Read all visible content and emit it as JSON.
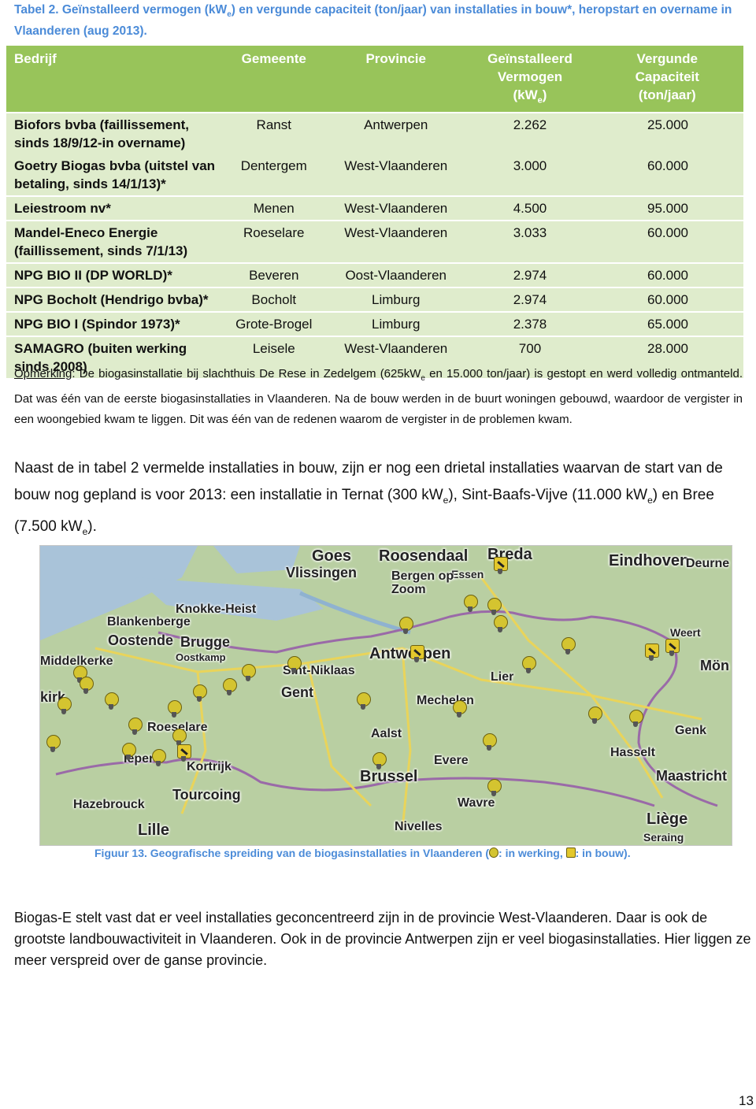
{
  "table_caption": {
    "part1": "Tabel 2. Geïnstalleerd vermogen (kW",
    "sub": "e",
    "part2": ") en vergunde capaciteit (ton/jaar) van installaties in bouw*, heropstart en overname in Vlaanderen (aug 2013)."
  },
  "table": {
    "headers": {
      "bedrijf": "Bedrijf",
      "gemeente": "Gemeente",
      "provincie": "Provincie",
      "vermogen_line1": "Geïnstalleerd",
      "vermogen_line2": "Vermogen",
      "vermogen_line3a": "(kW",
      "vermogen_sub": "e",
      "vermogen_line3b": ")",
      "capaciteit_line1": "Vergunde",
      "capaciteit_line2": "Capaciteit",
      "capaciteit_line3": "(ton/jaar)"
    },
    "rows": [
      {
        "bedrijf": "Biofors bvba (faillissement, sinds 18/9/12-in overname)",
        "gemeente": "Ranst",
        "provincie": "Antwerpen",
        "vermogen": "2.262",
        "capaciteit": "25.000"
      },
      {
        "bedrijf": "Goetry Biogas bvba (uitstel van betaling, sinds 14/1/13)*",
        "gemeente": "Dentergem",
        "provincie": "West-Vlaanderen",
        "vermogen": "3.000",
        "capaciteit": "60.000"
      },
      {
        "bedrijf": "Leiestroom nv*",
        "gemeente": "Menen",
        "provincie": "West-Vlaanderen",
        "vermogen": "4.500",
        "capaciteit": "95.000"
      },
      {
        "bedrijf": "Mandel-Eneco Energie (faillissement, sinds 7/1/13)",
        "gemeente": "Roeselare",
        "provincie": "West-Vlaanderen",
        "vermogen": "3.033",
        "capaciteit": "60.000"
      },
      {
        "bedrijf": "NPG BIO II (DP WORLD)*",
        "gemeente": "Beveren",
        "provincie": "Oost-Vlaanderen",
        "vermogen": "2.974",
        "capaciteit": "60.000"
      },
      {
        "bedrijf": "NPG Bocholt (Hendrigo bvba)*",
        "gemeente": "Bocholt",
        "provincie": "Limburg",
        "vermogen": "2.974",
        "capaciteit": "60.000"
      },
      {
        "bedrijf": "NPG BIO I (Spindor 1973)*",
        "gemeente": "Grote-Brogel",
        "provincie": "Limburg",
        "vermogen": "2.378",
        "capaciteit": "65.000"
      },
      {
        "bedrijf": "SAMAGRO (buiten werking sinds 2008)",
        "gemeente": "Leisele",
        "provincie": "West-Vlaanderen",
        "vermogen": "700",
        "capaciteit": "28.000"
      }
    ]
  },
  "remark": {
    "label": "Opmerking",
    "part1": ": De biogasinstallatie bij slachthuis De Rese in Zedelgem (625kW",
    "sub": "e",
    "part2": " en 15.000 ton/jaar) is gestopt en werd volledig ontmanteld. Dat was één van de eerste biogasinstallaties in Vlaanderen. Na de bouw werden in de buurt woningen gebouwd, waardoor de vergister in een woongebied kwam te liggen. Dit was één van de redenen waarom de vergister in de problemen kwam."
  },
  "paragraph1": {
    "part1": "Naast de in tabel 2 vermelde installaties in bouw, zijn er nog een drietal installaties waarvan de start van de bouw nog gepland is voor 2013: een installatie in Ternat (300 kW",
    "sub1": "e",
    "part2": "), Sint-Baafs-Vijve (11.000 kW",
    "sub2": "e",
    "part3": ") en Bree (7.500 kW",
    "sub3": "e",
    "part4": ")."
  },
  "map": {
    "cities": [
      "Goes",
      "Roosendaal",
      "Breda",
      "Vlissingen",
      "Essen",
      "Bergen op Zoom",
      "Eindhoven",
      "Deurne",
      "Knokke-Heist",
      "Blankenberge",
      "Oostende",
      "Middelkerke",
      "Brugge",
      "Oostkamp",
      "Weert",
      "Antwerpen",
      "Sint-Niklaas",
      "Gent",
      "Mechelen",
      "Lier",
      "Aalst",
      "Genk",
      "Hasselt",
      "Roeselare",
      "Ieper",
      "Kortrijk",
      "Brussel",
      "Evere",
      "Maastricht",
      "Tourcoing",
      "Hazebrouck",
      "Wavre",
      "Nivelles",
      "Lille",
      "Liège",
      "Seraing",
      "Mön",
      "kirk"
    ]
  },
  "figure_caption": {
    "part1": "Figuur 13. Geografische spreiding van de biogasinstallaties in Vlaanderen (",
    "part2": ": in werking, ",
    "part3": ": in bouw)."
  },
  "paragraph2": "Biogas-E stelt vast dat er veel installaties geconcentreerd zijn in de provincie West-Vlaanderen. Daar is ook de grootste landbouwactiviteit in Vlaanderen. Ook in de provincie Antwerpen zijn er veel biogasinstallaties. Hier liggen ze meer verspreid over de ganse provincie.",
  "page_number": "13"
}
